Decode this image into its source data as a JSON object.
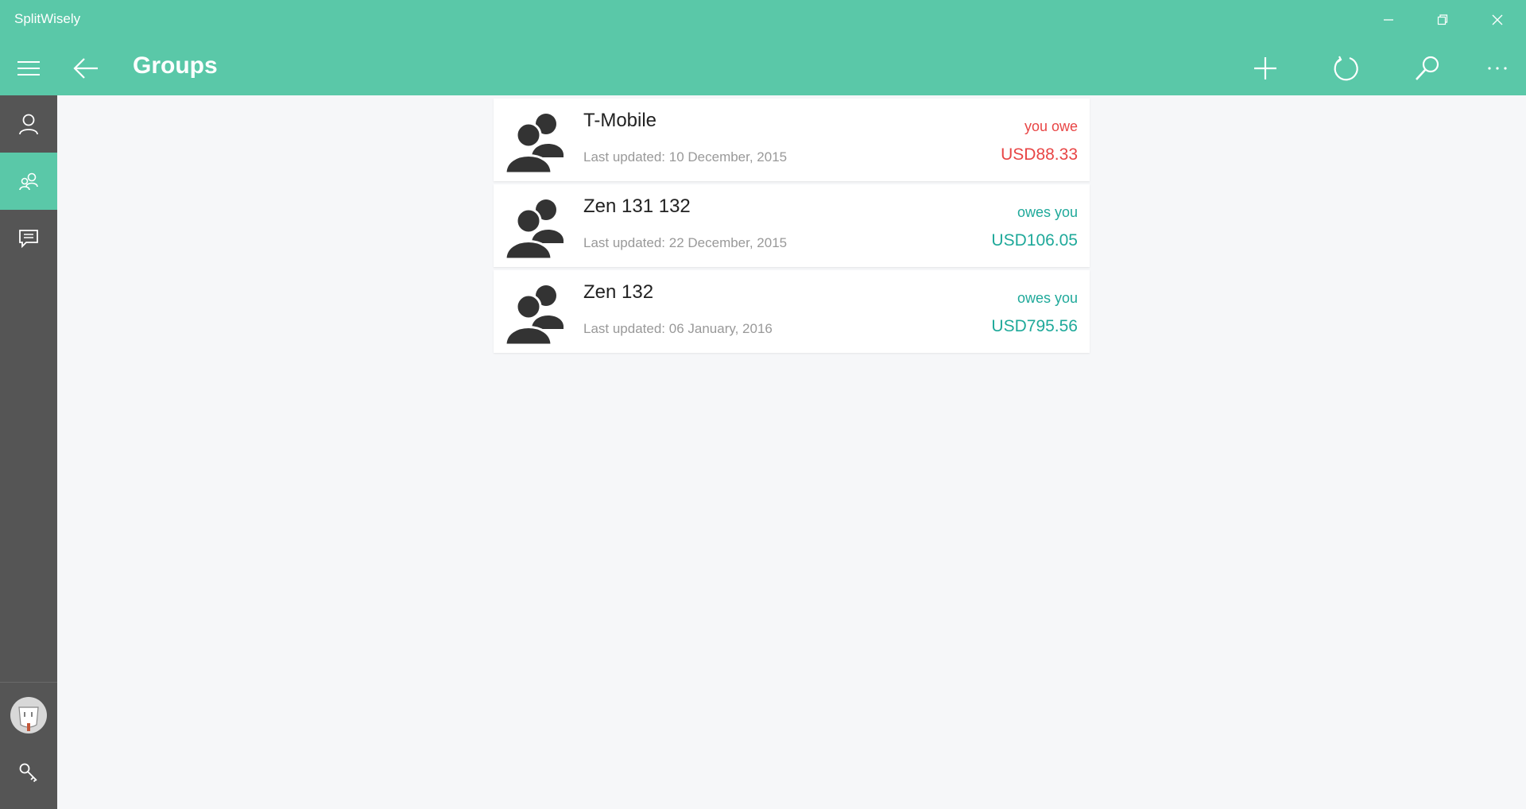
{
  "window": {
    "title": "SplitWisely"
  },
  "header": {
    "title": "Groups"
  },
  "colors": {
    "accent": "#5ac8a8",
    "sidebar_bg": "#555555",
    "owe_red": "#e84545",
    "owed_teal": "#1fa99a"
  },
  "toolbar": {
    "icons": [
      "hamburger-menu-icon",
      "back-arrow-icon",
      "add-icon",
      "refresh-icon",
      "search-icon",
      "more-icon"
    ]
  },
  "sidebar": {
    "items": [
      {
        "icon": "person-icon",
        "active": false
      },
      {
        "icon": "people-icon",
        "active": true
      },
      {
        "icon": "message-icon",
        "active": false
      }
    ],
    "bottom": [
      {
        "icon": "avatar"
      },
      {
        "icon": "key-icon"
      }
    ]
  },
  "groups": [
    {
      "name": "T-Mobile",
      "updated": "Last updated: 10 December, 2015",
      "status": "you owe",
      "amount": "USD88.33",
      "type": "owe"
    },
    {
      "name": "Zen 131 132",
      "updated": "Last updated: 22 December, 2015",
      "status": "owes you",
      "amount": "USD106.05",
      "type": "owed"
    },
    {
      "name": "Zen 132",
      "updated": "Last updated: 06 January, 2016",
      "status": "owes you",
      "amount": "USD795.56",
      "type": "owed"
    }
  ]
}
